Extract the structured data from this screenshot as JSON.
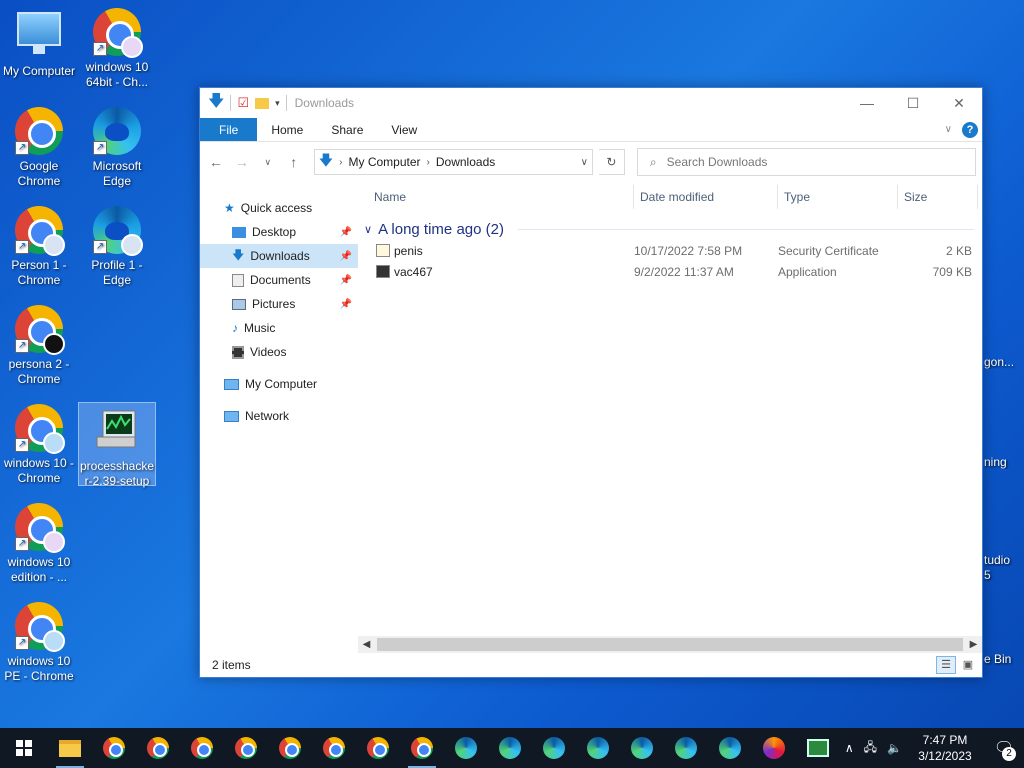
{
  "desktop": {
    "icons": [
      {
        "label": "My Computer",
        "type": "computer"
      },
      {
        "label": "windows 10 64bit - Ch...",
        "type": "chrome"
      },
      {
        "label": "Google Chrome",
        "type": "chrome"
      },
      {
        "label": "Microsoft Edge",
        "type": "edge"
      },
      {
        "label": "Person 1 - Chrome",
        "type": "chrome"
      },
      {
        "label": "Profile 1 - Edge",
        "type": "edge"
      },
      {
        "label": "persona 2 - Chrome",
        "type": "chrome"
      },
      {
        "label": "windows 10 - Chrome",
        "type": "chrome"
      },
      {
        "label": "processhacker-2.39-setup",
        "type": "installer"
      },
      {
        "label": "windows 10 edition - ...",
        "type": "chrome"
      },
      {
        "label": "windows 10 PE - Chrome",
        "type": "chrome"
      }
    ],
    "partial_right_icons": [
      "gon...",
      "ning",
      "tudio",
      "5",
      "e Bin"
    ]
  },
  "explorer": {
    "title": "Downloads",
    "ribbon": {
      "file": "File",
      "home": "Home",
      "share": "Share",
      "view": "View"
    },
    "address": {
      "root": "My Computer",
      "current": "Downloads"
    },
    "search_placeholder": "Search Downloads",
    "nav": {
      "quick_access": "Quick access",
      "desktop": "Desktop",
      "downloads": "Downloads",
      "documents": "Documents",
      "pictures": "Pictures",
      "music": "Music",
      "videos": "Videos",
      "my_computer": "My Computer",
      "network": "Network"
    },
    "columns": {
      "name": "Name",
      "date": "Date modified",
      "type": "Type",
      "size": "Size"
    },
    "group_label": "A long time ago (2)",
    "files": [
      {
        "name": "penis",
        "date": "10/17/2022 7:58 PM",
        "type": "Security Certificate",
        "size": "2 KB"
      },
      {
        "name": "vac467",
        "date": "9/2/2022 11:37 AM",
        "type": "Application",
        "size": "709 KB"
      }
    ],
    "status": "2 items"
  },
  "taskbar": {
    "time": "7:47 PM",
    "date": "3/12/2023",
    "notification_count": "2"
  }
}
